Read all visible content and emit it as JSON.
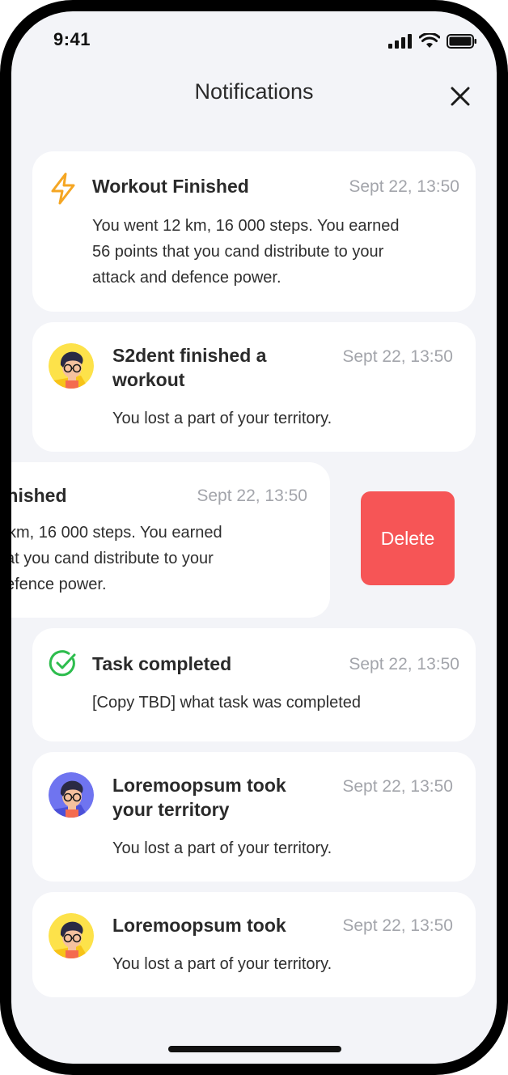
{
  "status": {
    "time": "9:41"
  },
  "header": {
    "title": "Notifications"
  },
  "notifications": [
    {
      "title": "Workout Finished",
      "time": "Sept 22, 13:50",
      "body_lines": [
        "You went 12 km, 16 000 steps. You earned",
        "56 points that you cand distribute to your",
        "attack and defence power."
      ],
      "icon": "lightning-icon"
    },
    {
      "title_lines": [
        "S2dent finished a",
        "workout"
      ],
      "time": "Sept 22, 13:50",
      "body": "You lost a part of your territory.",
      "icon": "avatar-yellow"
    },
    {
      "title": "inished",
      "time": "Sept 22, 13:50",
      "body_lines": [
        " km, 16 000 steps. You earned",
        "at you cand distribute to your",
        "efence power."
      ],
      "action": "Delete"
    },
    {
      "title": "Task completed",
      "time": "Sept 22, 13:50",
      "body": "[Copy TBD] what task was completed",
      "icon": "check-circle-icon"
    },
    {
      "title_lines": [
        "Loremoopsum took",
        "your territory"
      ],
      "time": "Sept 22, 13:50",
      "body": "You lost a part of your territory.",
      "icon": "avatar-blue"
    },
    {
      "title": "Loremoopsum took",
      "time": "Sept 22, 13:50",
      "body": "You lost a part of your territory.",
      "icon": "avatar-yellow"
    }
  ],
  "colors": {
    "background": "#f3f4f8",
    "card": "#ffffff",
    "delete": "#f65556",
    "lightning": "#f5a623",
    "check": "#2ebd4e",
    "timestamp": "#a3a5ab"
  }
}
